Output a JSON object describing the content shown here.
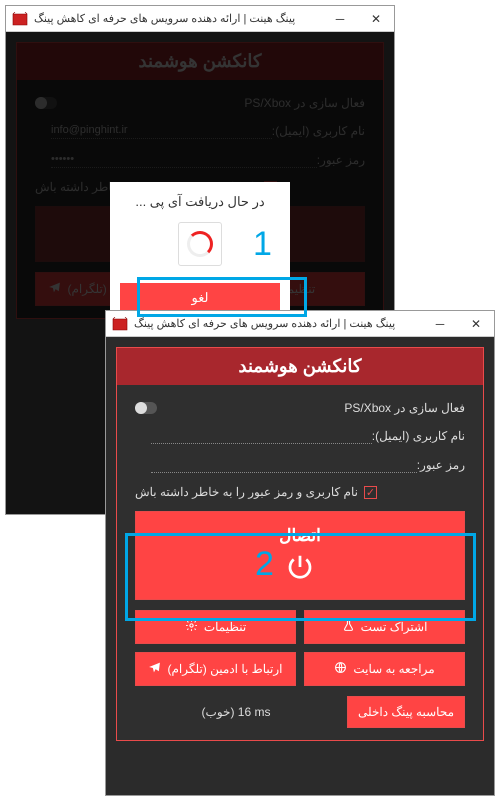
{
  "app": {
    "title": "پینگ هینت | ارائه دهنده سرویس های حرفه ای کاهش پینگ"
  },
  "panel": {
    "title": "کانکشن هوشمند"
  },
  "form": {
    "psxbox_label": "فعال سازی در PS/Xbox",
    "username_label": "نام کاربری (ایمیل):",
    "username_value": "info@pinghint.ir",
    "password_label": "رمز عبور:",
    "remember_label": "نام کاربری و رمز عبور را به خاطر داشته باش"
  },
  "modal": {
    "message": "در حال دریافت آی پی ...",
    "cancel": "لغو"
  },
  "connect": {
    "label": "اتصال"
  },
  "buttons": {
    "test_share": "اشتراک تست",
    "settings": "تنظیمات",
    "visit_site": "مراجعه به سایت",
    "contact_admin": "ارتباط با ادمین (تلگرام)"
  },
  "ping": {
    "calc_button": "محاسبه پینگ داخلی",
    "value": "(خوب)  16 ms"
  },
  "callouts": {
    "one": "1",
    "two": "2"
  }
}
